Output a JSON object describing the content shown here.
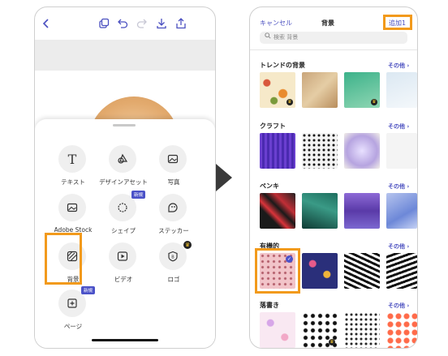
{
  "left_screen": {
    "tools": [
      {
        "label": "テキスト",
        "icon": "text-icon"
      },
      {
        "label": "デザインアセット",
        "icon": "design-asset-icon"
      },
      {
        "label": "写真",
        "icon": "photo-icon"
      },
      {
        "label": "Adobe Stock",
        "icon": "stock-icon"
      },
      {
        "label": "シェイプ",
        "icon": "shape-icon",
        "badge": "新規"
      },
      {
        "label": "ステッカー",
        "icon": "sticker-icon"
      },
      {
        "label": "背景",
        "icon": "background-icon"
      },
      {
        "label": "ビデオ",
        "icon": "video-icon"
      },
      {
        "label": "ロゴ",
        "icon": "logo-icon",
        "premium": true
      },
      {
        "label": "ページ",
        "icon": "page-icon",
        "badge": "新規"
      }
    ]
  },
  "right_screen": {
    "cancel_label": "キャンセル",
    "title": "背景",
    "add_label": "追加1",
    "search_placeholder": "検索 背景",
    "sections": [
      {
        "title": "トレンドの背景",
        "more": "その他 ›"
      },
      {
        "title": "クラフト",
        "more": "その他 ›"
      },
      {
        "title": "ペンキ",
        "more": "その他 ›"
      },
      {
        "title": "有機的",
        "more": "その他 ›"
      },
      {
        "title": "落書き",
        "more": "その他 ›"
      }
    ]
  },
  "colors": {
    "accent": "#4b52c8",
    "highlight": "#f29a1c"
  }
}
